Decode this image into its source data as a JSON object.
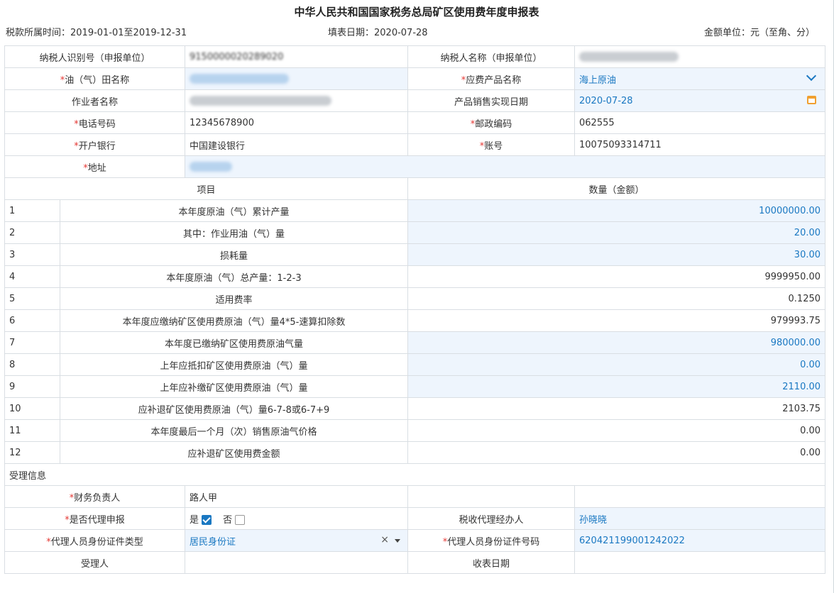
{
  "title": "中华人民共和国国家税务总局矿区使用费年度申报表",
  "meta": {
    "period": "税款所属时间：2019-01-01至2019-12-31",
    "fill_date": "填表日期：2020-07-28",
    "unit": "金额单位：元（至角、分）"
  },
  "info": {
    "taxpayer_id_label": "纳税人识别号（申报单位）",
    "taxpayer_id_value": "9150000020289020",
    "taxpayer_name_label": "纳税人名称（申报单位）",
    "field_name_label": "油（气）田名称",
    "product_name_label": "应费产品名称",
    "product_name_value": "海上原油",
    "operator_label": "作业者名称",
    "sale_date_label": "产品销售实现日期",
    "sale_date_value": "2020-07-28",
    "phone_label": "电话号码",
    "phone_value": "12345678900",
    "postcode_label": "邮政编码",
    "postcode_value": "062555",
    "bank_label": "开户银行",
    "bank_value": "中国建设银行",
    "account_label": "账号",
    "account_value": "10075093314711",
    "address_label": "地址",
    "required_mark": "*"
  },
  "table": {
    "col_item": "项目",
    "col_amount": "数量（金额）",
    "rows": [
      {
        "no": "1",
        "item": "本年度原油（气）累计产量",
        "value": "10000000.00"
      },
      {
        "no": "2",
        "item": "其中：作业用油（气）量",
        "value": "20.00"
      },
      {
        "no": "3",
        "item": "损耗量",
        "value": "30.00"
      },
      {
        "no": "4",
        "item": "本年度原油（气）总产量：1-2-3",
        "value": "9999950.00"
      },
      {
        "no": "5",
        "item": "适用费率",
        "value": "0.1250"
      },
      {
        "no": "6",
        "item": "本年度应缴纳矿区使用费原油（气）量4*5-速算扣除数",
        "value": "979993.75"
      },
      {
        "no": "7",
        "item": "本年度已缴纳矿区使用费原油气量",
        "value": "980000.00"
      },
      {
        "no": "8",
        "item": "上年应抵扣矿区使用费原油（气）量",
        "value": "0.00"
      },
      {
        "no": "9",
        "item": "上年应补缴矿区使用费原油（气）量",
        "value": "2110.00"
      },
      {
        "no": "10",
        "item": "应补退矿区使用费原油（气）量6-7-8或6-7+9",
        "value": "2103.75"
      },
      {
        "no": "11",
        "item": "本年度最后一个月（次）销售原油气价格",
        "value": "0.00"
      },
      {
        "no": "12",
        "item": "应补退矿区使用费金额",
        "value": "0.00"
      }
    ]
  },
  "acceptance": {
    "section_title": "受理信息",
    "finance_label": "财务负责人",
    "finance_value": "路人甲",
    "agent_declare_label": "是否代理申报",
    "yes_label": "是",
    "no_label": "否",
    "agent_handler_label": "税收代理经办人",
    "agent_handler_value": "孙晓晓",
    "id_type_label": "代理人员身份证件类型",
    "id_type_value": "居民身份证",
    "id_type_clear": "×",
    "id_number_label": "代理人员身份证件号码",
    "id_number_value": "620421199001242022",
    "receiver_label": "受理人",
    "receive_date_label": "收表日期"
  }
}
